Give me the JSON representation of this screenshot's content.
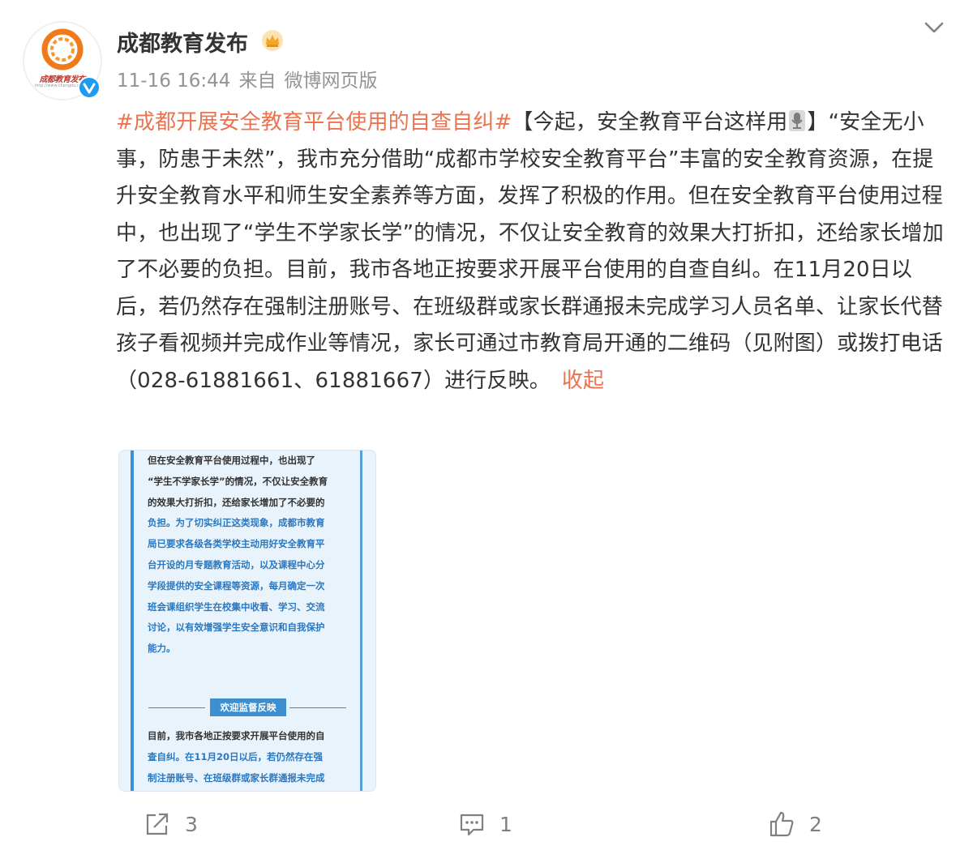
{
  "account": {
    "name": "成都教育发布",
    "avatar_text": "成都教育发布",
    "avatar_url_text": "http://www.chengdu.edu.cn",
    "verified_icon": "verified-badge-icon",
    "crown_icon": "crown-icon"
  },
  "meta": {
    "time": "11-16 16:44",
    "source_prefix": "来自",
    "source": "微博网页版"
  },
  "post": {
    "topic": "#成都开展安全教育平台使用的自查自纠#",
    "head_before_icon": "【今起，安全教育平台这样用",
    "head_after_icon": "】“安全无小事，防患于未然”，我市充分借助“成都市学校安全教育平台”丰富的安全教育资源，在提升安全教育水平和师生安全素养等方面，发挥了积极的作用。但在安全教育平台使用过程中，也出现了“学生不学家长学”的情况，不仅让安全教育的效果大打折扣，还给家长增加了不必要的负担。目前，我市各地正按要求开展平台使用的自查自纠。在11月20日以后，若仍然存在强制注册账号、在班级群或家长群通报未完成学习人员名单、让家长代替孩子看视频并完成作业等情况，家长可通过市教育局开通的二维码（见附图）或拨打电话（028-61881661、61881667）进行反映。",
    "collapse_label": "收起",
    "embedded_icon": "microphone-icon"
  },
  "attachment": {
    "lines": [
      {
        "text": "但在安全教育平台使用过程中，也出现了",
        "color": "#333333"
      },
      {
        "text": "“学生不学家长学”的情况，不仅让安全教育",
        "color": "#333333"
      },
      {
        "text": "的效果大打折扣，还给家长增加了不必要的",
        "color": "#333333"
      },
      {
        "text": "负担。为了切实纠正这类现象，成都市教育",
        "color": "#2a78c1"
      },
      {
        "text": "局已要求各级各类学校主动用好安全教育平",
        "color": "#2a78c1"
      },
      {
        "text": "台开设的月专题教育活动，以及课程中心分",
        "color": "#2a78c1"
      },
      {
        "text": "学段提供的安全课程等资源，每月确定一次",
        "color": "#2a78c1"
      },
      {
        "text": "班会课组织学生在校集中收看、学习、交流",
        "color": "#2a78c1"
      },
      {
        "text": "讨论，以有效增强学生安全意识和自我保护",
        "color": "#2a78c1"
      },
      {
        "text": "能力。",
        "color": "#2a78c1"
      }
    ],
    "section_tag": "欢迎监督反映",
    "lines2": [
      {
        "text": "目前，我市各地正按要求开展平台使用的自",
        "color": "#333333"
      },
      {
        "text": "查自纠。在11月20日以后，若仍然存在强",
        "color": "#2a78c1"
      },
      {
        "text": "制注册账号、在班级群或家长群通报未完成",
        "color": "#2a78c1"
      }
    ]
  },
  "actions": {
    "forward_count": "3",
    "comment_count": "1",
    "like_count": "2"
  },
  "colors": {
    "accent": "#eb7350",
    "meta_gray": "#939393",
    "verified_blue": "#1e9bf0",
    "attachment_blue": "#3d8fd0"
  }
}
